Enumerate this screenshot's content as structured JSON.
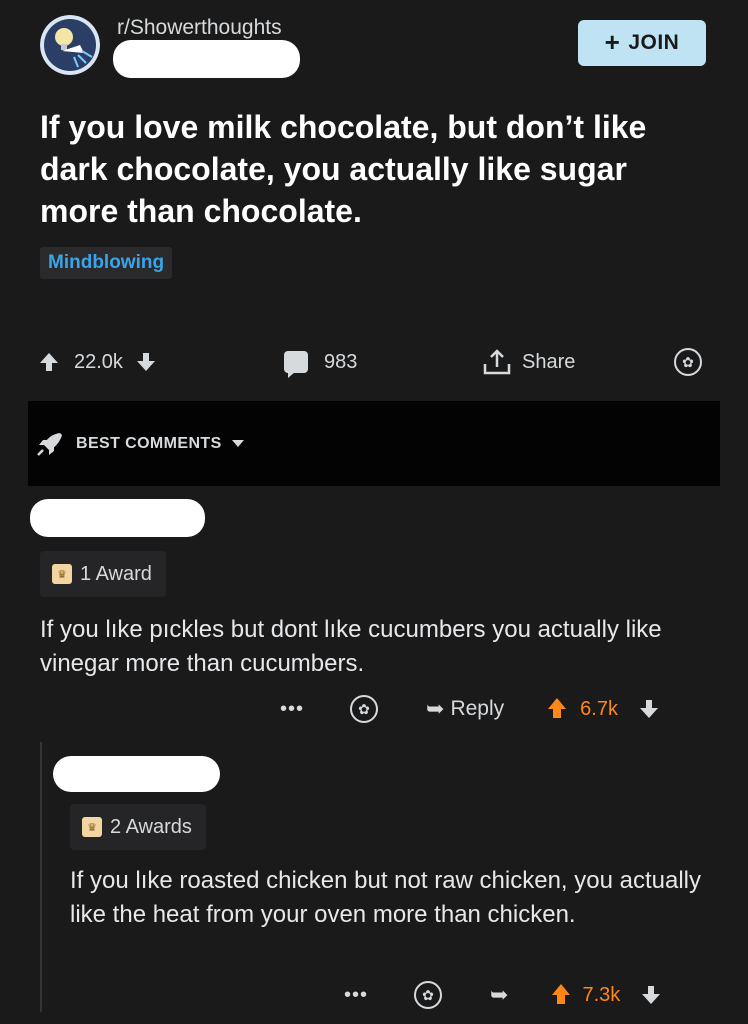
{
  "post": {
    "subreddit": "r/Showerthoughts",
    "join_label": "JOIN",
    "title": "If you love milk chocolate, but don’t like dark chocolate, you actually like sugar more than chocolate.",
    "flair": "Mindblowing",
    "score": "22.0k",
    "comments": "983",
    "share_label": "Share"
  },
  "sort": {
    "label": "BEST COMMENTS"
  },
  "comments": [
    {
      "awards": "1 Award",
      "text": "If you lıke pıckles but dont lıke cucumbers you actually like vinegar more than cucumbers.",
      "more": "•••",
      "reply_label": "Reply",
      "score": "6.7k"
    },
    {
      "awards": "2 Awards",
      "text": "If you lıke roasted chicken but not raw chicken, you actually like the heat from your oven more than chicken.",
      "more": "•••",
      "score": "7.3k"
    }
  ],
  "colors": {
    "background": "#1a1a1b",
    "join_bg": "#bfe3f3",
    "flair_text": "#3aa4e8",
    "upvoted": "#ff8717"
  },
  "icons": [
    "subreddit-avatar",
    "plus-icon",
    "upvote-icon",
    "downvote-icon",
    "comment-icon",
    "share-icon",
    "award-icon",
    "rocket-icon",
    "caret-down-icon",
    "award-badge-icon",
    "more-icon",
    "reply-icon"
  ]
}
